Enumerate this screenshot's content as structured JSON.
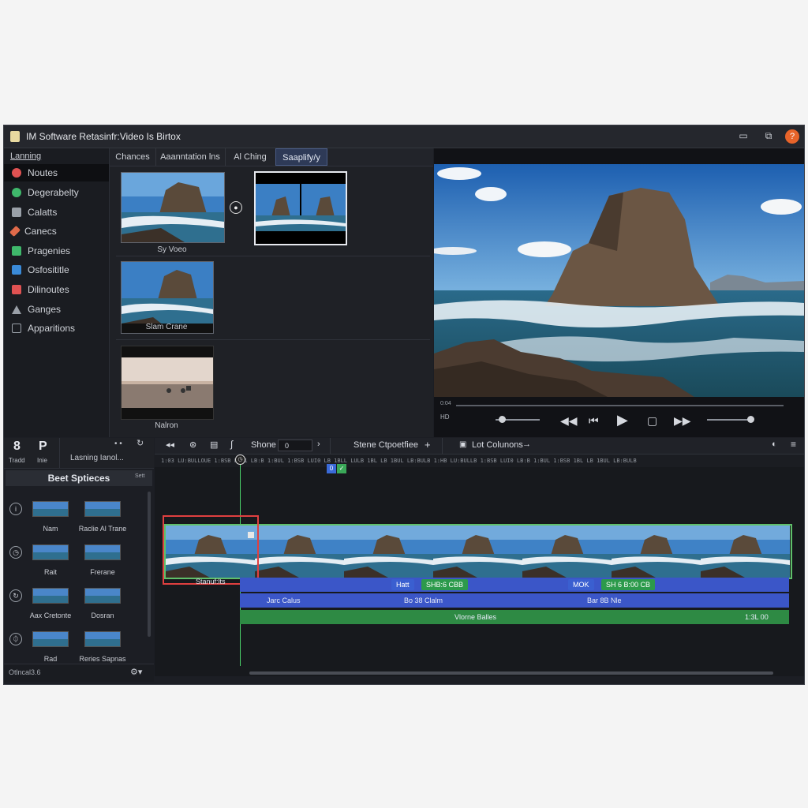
{
  "window": {
    "title": "IM Software Retasinfr:Video Is Birtox",
    "controls": [
      "restore-icon",
      "maximize-icon"
    ],
    "close_label": "?"
  },
  "sidebar": {
    "header": "Lanning",
    "items": [
      {
        "label": "Noutes",
        "icon": "record-icon",
        "color": "#e05252",
        "active": true
      },
      {
        "label": "Degerabelty",
        "icon": "circle-icon",
        "color": "#3fb86b"
      },
      {
        "label": "Calatts",
        "icon": "folder-icon",
        "color": "#9aa0a8"
      },
      {
        "label": "Canecs",
        "icon": "brush-icon",
        "color": "#e06a4a"
      },
      {
        "label": "Pragenies",
        "icon": "image-icon",
        "color": "#3fb86b"
      },
      {
        "label": "Osfosititle",
        "icon": "monitor-icon",
        "color": "#3a8ad8"
      },
      {
        "label": "Dilinoutes",
        "icon": "clapper-icon",
        "color": "#e05252"
      },
      {
        "label": "Ganges",
        "icon": "triangle-icon",
        "color": "#9aa0a8"
      },
      {
        "label": "Apparitions",
        "icon": "monitor-outline-icon",
        "color": "#9aa0a8"
      }
    ]
  },
  "media_tabs": [
    {
      "label": "Chances"
    },
    {
      "label": "Aaanntation lns"
    },
    {
      "label": "Al Ching"
    },
    {
      "label": "Saaplify/y",
      "active": true
    }
  ],
  "media": {
    "clips": [
      {
        "caption": "Sy Voeo"
      },
      {
        "caption": ""
      },
      {
        "caption": "Slam Crane"
      },
      {
        "caption": "Nalron"
      }
    ]
  },
  "preview": {
    "time_left": "0:04",
    "quality_left": "HD",
    "transport": [
      "rewind-icon",
      "skip-back-icon",
      "play-icon",
      "stop-icon",
      "fast-forward-icon"
    ],
    "position": 0.14,
    "volume": 0.95
  },
  "tools": {
    "big1": "8",
    "small1": "Tradd",
    "big2": "P",
    "small2": "Inie",
    "loading": "Lasning Ianol..."
  },
  "effects": {
    "title": "Beet Sptieces",
    "settings": "Sett",
    "rows": [
      {
        "icon": "info-icon",
        "items": [
          "Nam",
          "Raclie Al Trane"
        ]
      },
      {
        "icon": "clock-icon",
        "items": [
          "Rait",
          "Frerane"
        ]
      },
      {
        "icon": "refresh-icon",
        "items": [
          "Aax Cretonte",
          "Dosran"
        ]
      },
      {
        "icon": "pin-icon",
        "items": [
          "Rad",
          "Reries Sapnas"
        ]
      }
    ],
    "footer": "Otlncal3.6"
  },
  "timeline_toolbar": {
    "scene_label": "Shone",
    "scene_value": "0",
    "speed_label": "Stene Ctpoetfiee",
    "columns_label": "Lot Colunons"
  },
  "timeline": {
    "ruler": "1:03 LU:BULLOUE 1:BSB LUI1 LB:B 1:BUL 1:BSB LUI0 LB 1BLL LULB 1BL LB 1BUL LB:BULB 1:HB LU:BULLB 1:BSB LUI0 LB:B 1:BUL 1:BSB 1BL LB 1BUL LB:BULB",
    "marker_badge": "0",
    "clip_caption": "Stanuf:lts",
    "chips": [
      {
        "label": "Hatt",
        "color": "#3a5fd0"
      },
      {
        "label": "SHB:6 CBB",
        "color": "#2c9a4b"
      },
      {
        "label": "MOK",
        "color": "#3a5fd0"
      },
      {
        "label": "SH 6 B:00 CB",
        "color": "#2c9a4b"
      }
    ],
    "tracks": [
      {
        "labels": [
          "Jarc Calus",
          "Bo 38 Clalm",
          "Bar 8B Nle"
        ],
        "color": "#3b56c8"
      },
      {
        "labels": [
          "Vlorne Balles",
          "1:3L 00"
        ],
        "color": "#2e8a44"
      }
    ]
  }
}
